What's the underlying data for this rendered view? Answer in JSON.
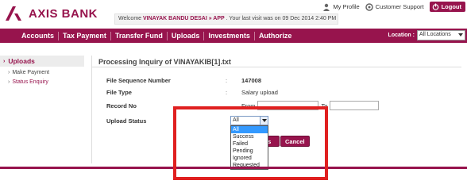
{
  "brand": {
    "name": "AXIS BANK",
    "color": "#97144d"
  },
  "header": {
    "welcome_prefix": "Welcome ",
    "user_name": "VINAYAK BANDU DESAI » APP",
    "welcome_suffix": " . Your last visit was on 09 Dec 2014 2:40 PM",
    "links": [
      {
        "label": "My Profile",
        "icon": "user-icon"
      },
      {
        "label": "Customer Support",
        "icon": "support-icon"
      }
    ],
    "logout_label": "Logout"
  },
  "nav": {
    "items": [
      "Accounts",
      "Tax Payment",
      "Transfer Fund",
      "Uploads",
      "Investments",
      "Authorize"
    ],
    "location_label": "Location :",
    "location_value": "All Locations"
  },
  "sidebar": {
    "section": "Uploads",
    "items": [
      "Make Payment",
      "Status Enquiry"
    ]
  },
  "main": {
    "title": "Processing Inquiry of VINAYAKIB[1].txt",
    "fields": [
      {
        "label": "File Sequence Number",
        "sep": ":",
        "value": "147008"
      },
      {
        "label": "File Type",
        "sep": ":",
        "value": "Salary upload"
      },
      {
        "label": "Record No",
        "from": "From",
        "to": "To"
      },
      {
        "label": "Upload Status"
      }
    ],
    "upload_status": {
      "selected": "All",
      "options": [
        "All",
        "Success",
        "Failed",
        "Pending",
        "Ignored",
        "Requested"
      ]
    },
    "details_button": "ils",
    "cancel_button": "Cancel"
  }
}
